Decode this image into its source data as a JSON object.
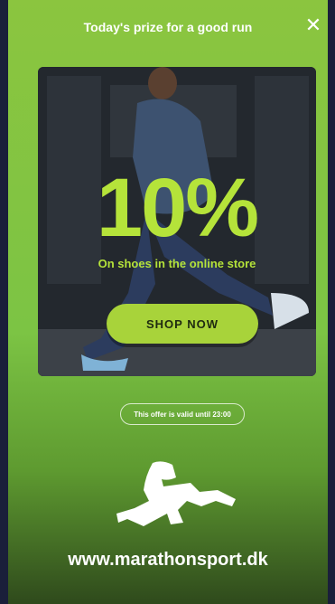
{
  "header": {
    "title": "Today's prize for a good run"
  },
  "icons": {
    "close": "close-icon",
    "logo": "running-man-logo"
  },
  "promo": {
    "percent": "10%",
    "subtitle": "On shoes in the online store",
    "button_label": "SHOP NOW"
  },
  "offer": {
    "validity": "This offer is valid until 23:00"
  },
  "footer": {
    "url": "www.marathonsport.dk"
  },
  "colors": {
    "accent": "#a8d33a",
    "background": "#8bc53f",
    "text": "#ffffff"
  }
}
